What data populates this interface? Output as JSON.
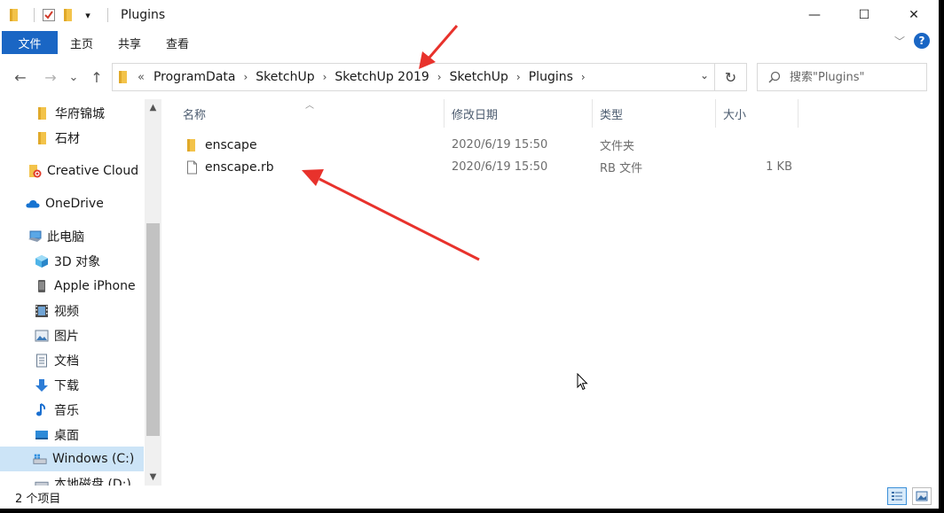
{
  "window": {
    "title": "Plugins",
    "minimize_glyph": "—",
    "maximize_glyph": "☐",
    "close_glyph": "✕",
    "qa_dropdown_glyph": "▾"
  },
  "ribbon": {
    "tabs": [
      "文件",
      "主页",
      "共享",
      "查看"
    ],
    "expand_glyph": "﹀",
    "help_glyph": "?"
  },
  "nav": {
    "back_glyph": "←",
    "forward_glyph": "→",
    "recent_glyph": "⌄",
    "up_glyph": "↑",
    "overflow_glyph": "«"
  },
  "address": {
    "crumbs": [
      "ProgramData",
      "SketchUp",
      "SketchUp 2019",
      "SketchUp",
      "Plugins"
    ],
    "separator": "›",
    "dropdown_glyph": "⌄",
    "refresh_glyph": "↻"
  },
  "search": {
    "placeholder": "搜索\"Plugins\""
  },
  "sidebar": {
    "items": [
      {
        "label": "华府锦城",
        "icon": "folder-icon"
      },
      {
        "label": "石材",
        "icon": "folder-icon"
      },
      {
        "label": "Creative Cloud Files",
        "icon": "creative-cloud-icon"
      },
      {
        "label": "OneDrive",
        "icon": "onedrive-icon"
      },
      {
        "label": "此电脑",
        "icon": "computer-icon"
      },
      {
        "label": "3D 对象",
        "icon": "3d-objects-icon"
      },
      {
        "label": "Apple iPhone",
        "icon": "iphone-icon"
      },
      {
        "label": "视频",
        "icon": "video-icon"
      },
      {
        "label": "图片",
        "icon": "pictures-icon"
      },
      {
        "label": "文档",
        "icon": "documents-icon"
      },
      {
        "label": "下载",
        "icon": "downloads-icon"
      },
      {
        "label": "音乐",
        "icon": "music-icon"
      },
      {
        "label": "桌面",
        "icon": "desktop-icon"
      },
      {
        "label": "Windows (C:)",
        "icon": "drive-c-icon"
      },
      {
        "label": "本地磁盘 (D:)",
        "icon": "drive-d-icon"
      }
    ],
    "scroll_up_glyph": "▲",
    "scroll_down_glyph": "▼"
  },
  "table": {
    "columns": [
      "名称",
      "修改日期",
      "类型",
      "大小"
    ],
    "sort_glyph": "︿",
    "rows": [
      {
        "name": "enscape",
        "modified": "2020/6/19 15:50",
        "type": "文件夹",
        "size": "",
        "icon": "folder-icon"
      },
      {
        "name": "enscape.rb",
        "modified": "2020/6/19 15:50",
        "type": "RB 文件",
        "size": "1 KB",
        "icon": "file-icon"
      }
    ]
  },
  "status": {
    "item_count": "2 个项目"
  },
  "colors": {
    "accent": "#1a66c4",
    "folder": "#f3c34a",
    "selected": "#cce4f7",
    "annotation_arrow": "#e8322c"
  }
}
